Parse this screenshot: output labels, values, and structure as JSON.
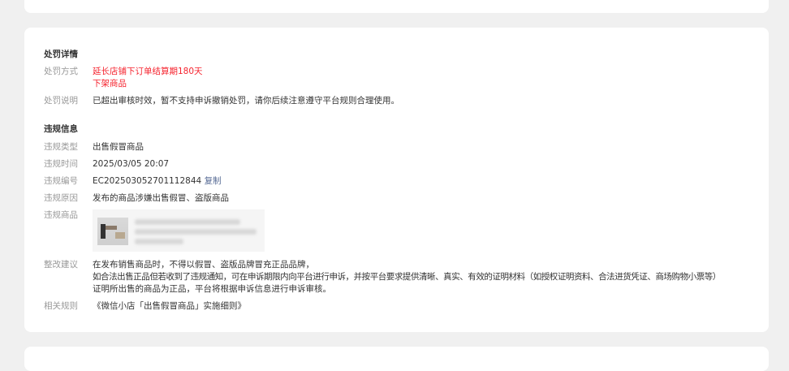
{
  "penalty": {
    "title": "处罚详情",
    "method_label": "处罚方式",
    "methods": [
      "延长店铺下订单结算期180天",
      "下架商品"
    ],
    "desc_label": "处罚说明",
    "desc": "已超出审核时效，暂不支持申诉撤销处罚，请你后续注意遵守平台规则合理使用。"
  },
  "violation": {
    "title": "违规信息",
    "type_label": "违规类型",
    "type": "出售假冒商品",
    "time_label": "违规时间",
    "time": "2025/03/05 20:07",
    "id_label": "违规编号",
    "id": "EC20250305270111284​4",
    "copy_label": "复制",
    "reason_label": "违规原因",
    "reason": "发布的商品涉嫌出售假冒、盗版商品",
    "product_label": "违规商品"
  },
  "rectify": {
    "label": "整改建议",
    "lines": [
      "在发布销售商品时，不得以假冒、盗版品牌冒充正品品牌，",
      "如合法出售正品但若收到了违规通知，可在申诉期限内向平台进行申诉，并按平台要求提供清晰、真实、有效的证明材料（如授权证明资料、合法进货凭证、商场购物小票等）",
      "证明所出售的商品为正品，平台将根据申诉信息进行申诉审核。"
    ]
  },
  "rules": {
    "label": "相关规则",
    "link": "《微信小店「出售假冒商品」实施细则》"
  }
}
